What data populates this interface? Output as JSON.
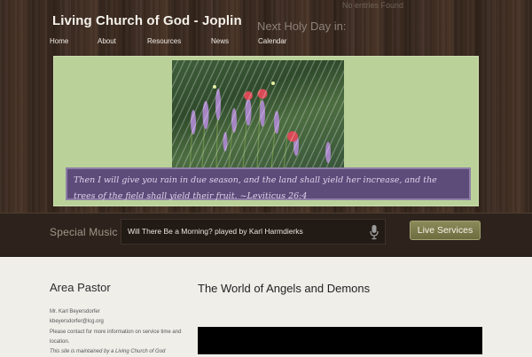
{
  "site": {
    "title": "Living Church of God - Joplin"
  },
  "header": {
    "holy_day_label": "Next Holy Day in:",
    "no_entries": "No entries Found"
  },
  "nav": [
    "Home",
    "About",
    "Resources",
    "News",
    "Calendar"
  ],
  "banner": {
    "verse_line1": "Then I will give you rain in due season, and the land shall yield her increase, and the",
    "verse_line2": "trees of the field shall yield their fruit. ~Leviticus 26:4"
  },
  "music": {
    "label": "Special Music",
    "now_playing": "Will There Be a Morning? played by Karl Harmdierks",
    "live_button": "Live Services"
  },
  "sidebar": {
    "heading": "Area Pastor",
    "name": "Mr. Karl Beyersdorfer",
    "email": "kbeyersdorfer@lcg.org",
    "contact_note": "Please contact for more information on service time and location.",
    "maintained": "This site is maintained by a Living Church of God"
  },
  "main": {
    "article_title": "The World of Angels and Demons"
  },
  "colors": {
    "banner_green": "#bad29a",
    "verse_purple": "#5d4b7a",
    "wood_dark": "#3a2a20",
    "button_olive": "#7c7c4d"
  }
}
